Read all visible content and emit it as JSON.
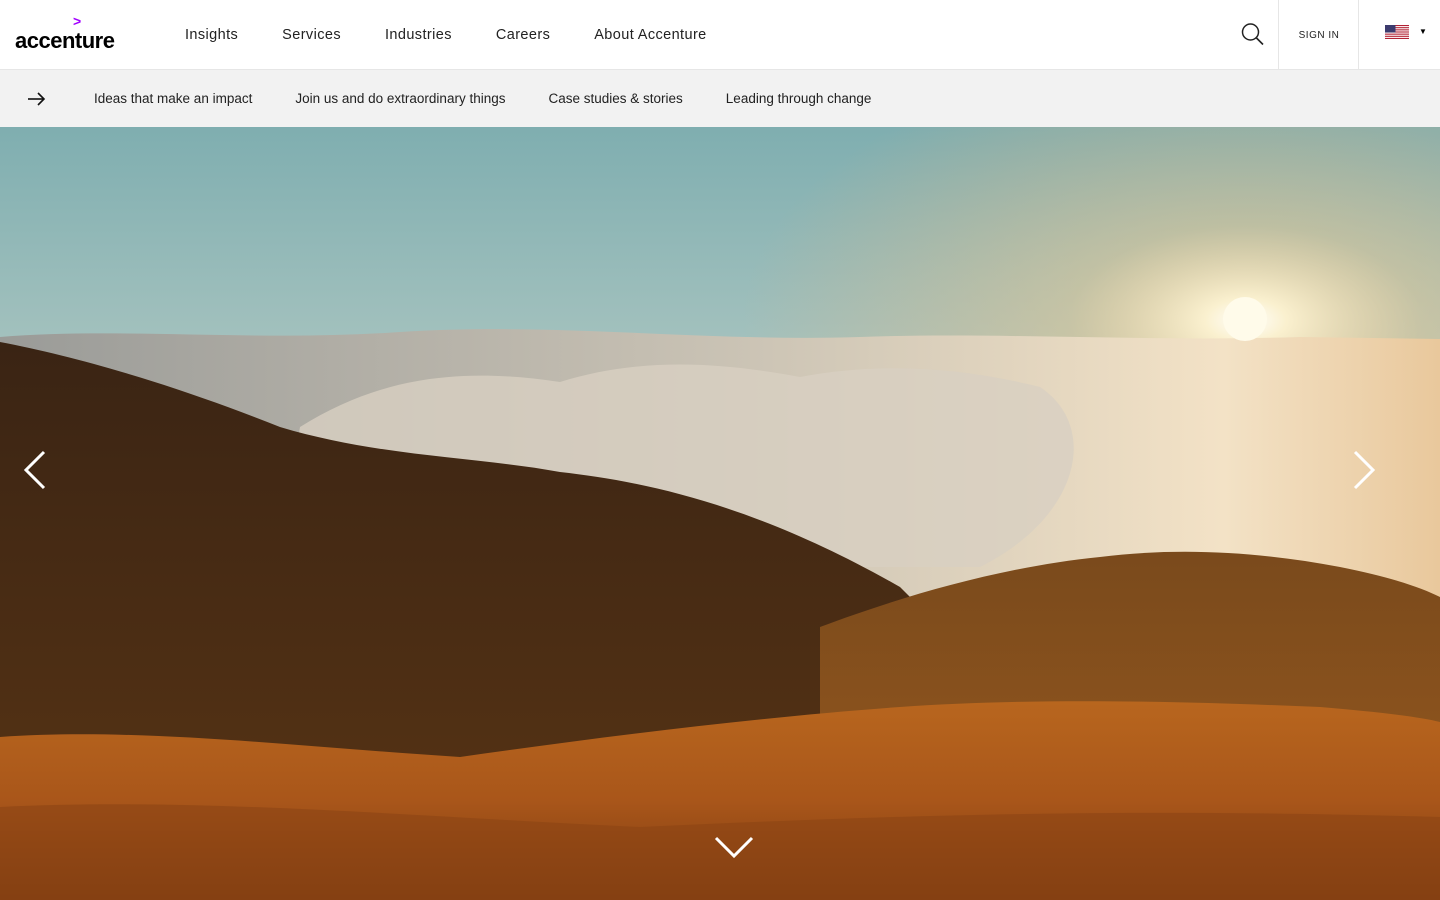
{
  "logo": {
    "mark": ">",
    "text": "accenture",
    "accent_color": "#a100ff"
  },
  "nav": {
    "items": [
      {
        "label": "Insights"
      },
      {
        "label": "Services"
      },
      {
        "label": "Industries"
      },
      {
        "label": "Careers"
      },
      {
        "label": "About Accenture"
      }
    ]
  },
  "header": {
    "search_icon": "search-icon",
    "signin_label": "SIGN IN",
    "country_icon": "us-flag-icon"
  },
  "subnav": {
    "arrow_icon": "arrow-right-icon",
    "items": [
      {
        "label": "Ideas that make an impact"
      },
      {
        "label": "Join us and do extraordinary things"
      },
      {
        "label": "Case studies & stories"
      },
      {
        "label": "Leading through change"
      }
    ]
  },
  "hero": {
    "image": "mountain-sunrise-above-clouds",
    "prev_icon": "chevron-left-icon",
    "next_icon": "chevron-right-icon",
    "down_icon": "chevron-down-icon"
  }
}
